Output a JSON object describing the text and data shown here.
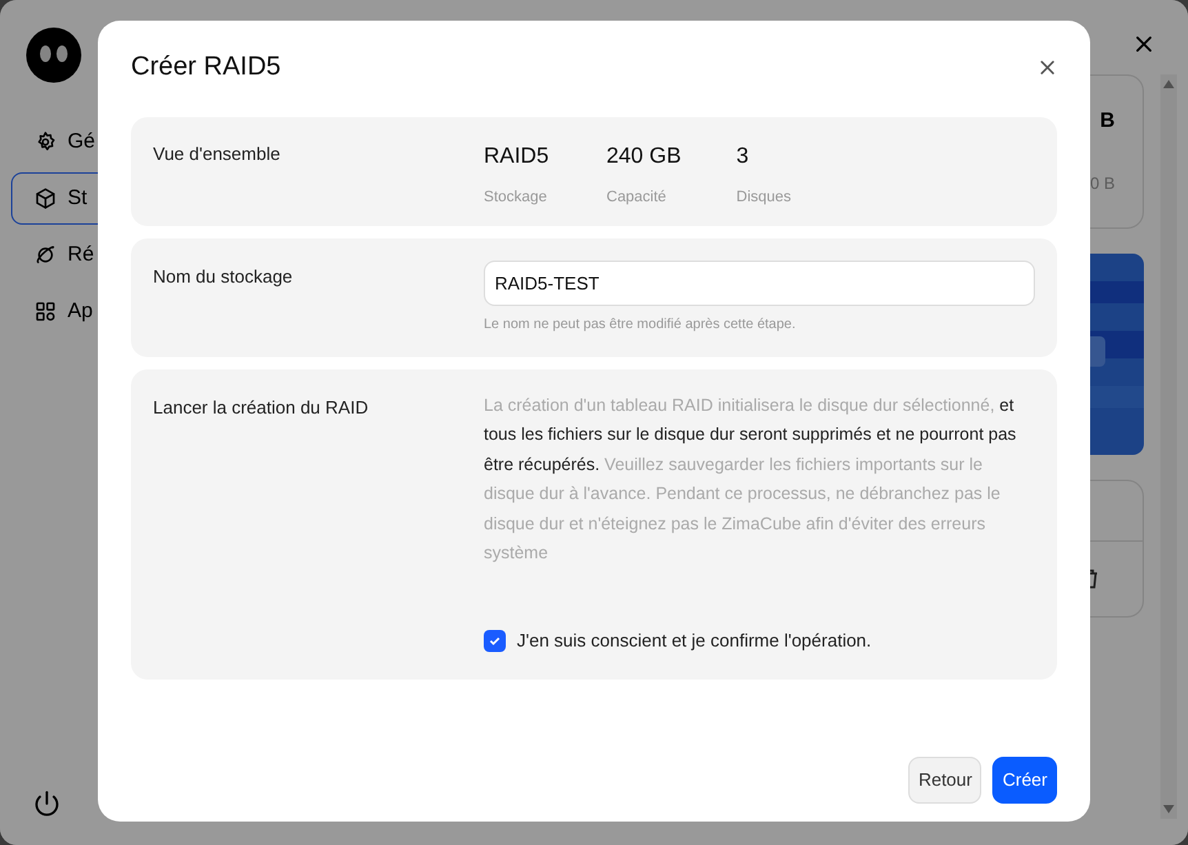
{
  "background": {
    "sidebar": {
      "items": [
        {
          "label": "Gé",
          "kind": "gear",
          "selected": false
        },
        {
          "label": "St",
          "kind": "box",
          "selected": true
        },
        {
          "label": "Ré",
          "kind": "planet",
          "selected": false
        },
        {
          "label": "Ap",
          "kind": "apps",
          "selected": false
        }
      ]
    },
    "summary_card": {
      "value": "B",
      "sub_value": "0 B"
    }
  },
  "dialog": {
    "title": "Créer RAID5",
    "overview": {
      "label": "Vue d'ensemble",
      "stats": [
        {
          "value": "RAID5",
          "caption": "Stockage"
        },
        {
          "value": "240 GB",
          "caption": "Capacité"
        },
        {
          "value": "3",
          "caption": "Disques"
        }
      ]
    },
    "name": {
      "label": "Nom du stockage",
      "value": "RAID5-TEST",
      "hint": "Le nom ne peut pas être modifié après cette étape."
    },
    "create": {
      "label": "Lancer la création du RAID",
      "warning": [
        {
          "text": "La création d'un tableau RAID initialisera le disque dur sélectionné, ",
          "emphasis": false
        },
        {
          "text": "et tous les fichiers sur le disque dur seront supprimés et ne pourront pas être récupérés.",
          "emphasis": true
        },
        {
          "text": " Veuillez sauvegarder les fichiers importants sur le disque dur à l'avance. Pendant ce processus, ne débranchez pas le disque dur et n'éteignez pas le ZimaCube afin d'éviter des erreurs système",
          "emphasis": false
        }
      ],
      "confirm": {
        "label": "J'en suis conscient et je confirme l'opération.",
        "checked": true
      }
    },
    "buttons": [
      {
        "label": "Retour",
        "kind": "secondary"
      },
      {
        "label": "Créer",
        "kind": "primary"
      }
    ]
  }
}
